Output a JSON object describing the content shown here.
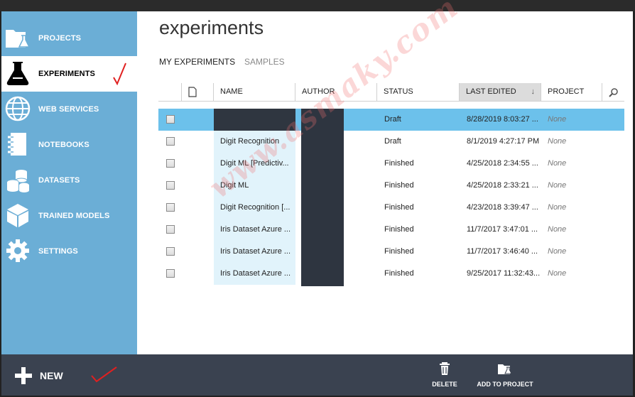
{
  "sidebar": {
    "items": [
      {
        "label": "PROJECTS",
        "icon": "projects-folder-flask-icon",
        "active": false
      },
      {
        "label": "EXPERIMENTS",
        "icon": "flask-icon",
        "active": true
      },
      {
        "label": "WEB SERVICES",
        "icon": "globe-icon",
        "active": false
      },
      {
        "label": "NOTEBOOKS",
        "icon": "notebook-icon",
        "active": false
      },
      {
        "label": "DATASETS",
        "icon": "datasets-cylinders-icon",
        "active": false
      },
      {
        "label": "TRAINED MODELS",
        "icon": "cube-icon",
        "active": false
      },
      {
        "label": "SETTINGS",
        "icon": "gear-icon",
        "active": false
      }
    ]
  },
  "main": {
    "title": "experiments",
    "tabs": [
      {
        "label": "MY EXPERIMENTS",
        "active": true
      },
      {
        "label": "SAMPLES",
        "active": false
      }
    ]
  },
  "table": {
    "columns": [
      "NAME",
      "AUTHOR",
      "STATUS",
      "LAST EDITED",
      "PROJECT"
    ],
    "sorted_column": "LAST EDITED",
    "sort_direction": "descending",
    "rows": [
      {
        "name": "",
        "status": "Draft",
        "last_edited": "8/28/2019 8:03:27 ...",
        "project": "None",
        "selected": true
      },
      {
        "name": "Digit Recognition",
        "status": "Draft",
        "last_edited": "8/1/2019 4:27:17 PM",
        "project": "None",
        "selected": false
      },
      {
        "name": "Digit ML [Predictiv...",
        "status": "Finished",
        "last_edited": "4/25/2018 2:34:55 ...",
        "project": "None",
        "selected": false
      },
      {
        "name": "Digit ML",
        "status": "Finished",
        "last_edited": "4/25/2018 2:33:21 ...",
        "project": "None",
        "selected": false
      },
      {
        "name": "Digit Recognition [...",
        "status": "Finished",
        "last_edited": "4/23/2018 3:39:47 ...",
        "project": "None",
        "selected": false
      },
      {
        "name": "Iris Dataset Azure ...",
        "status": "Finished",
        "last_edited": "11/7/2017 3:47:01 ...",
        "project": "None",
        "selected": false
      },
      {
        "name": "Iris Dataset Azure ...",
        "status": "Finished",
        "last_edited": "11/7/2017 3:46:40 ...",
        "project": "None",
        "selected": false
      },
      {
        "name": "Iris Dataset Azure ...",
        "status": "Finished",
        "last_edited": "9/25/2017 11:32:43...",
        "project": "None",
        "selected": false
      }
    ]
  },
  "bottombar": {
    "new_label": "NEW",
    "delete_label": "DELETE",
    "add_to_project_label": "ADD TO PROJECT"
  },
  "watermark": "www.asmaky.com",
  "colors": {
    "sidebar": "#6baed6",
    "selected_row": "#6cc1eb",
    "bottombar": "#3a4250",
    "annotation_red": "#e02020"
  }
}
